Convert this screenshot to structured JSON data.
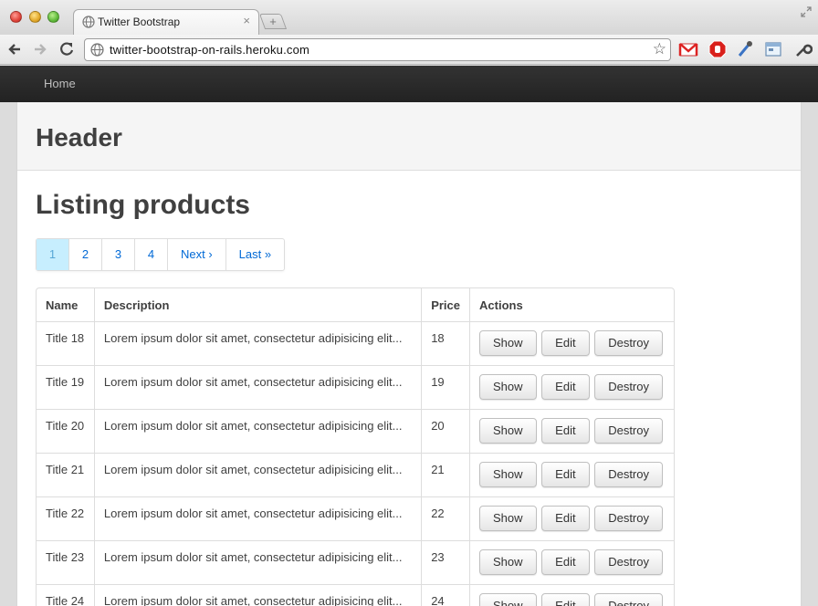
{
  "browser": {
    "tab_title": "Twitter Bootstrap",
    "tab_close": "×",
    "new_tab": "+",
    "url": "twitter-bootstrap-on-rails.heroku.com",
    "star": "☆"
  },
  "navbar": {
    "home": "Home"
  },
  "hero": {
    "title": "Header"
  },
  "main": {
    "title": "Listing products",
    "pagination": [
      "1",
      "2",
      "3",
      "4",
      "Next ›",
      "Last »"
    ],
    "table": {
      "headers": [
        "Name",
        "Description",
        "Price",
        "Actions"
      ],
      "rows": [
        {
          "name": "Title 18",
          "description": "Lorem ipsum dolor sit amet, consectetur adipisicing elit...",
          "price": "18"
        },
        {
          "name": "Title 19",
          "description": "Lorem ipsum dolor sit amet, consectetur adipisicing elit...",
          "price": "19"
        },
        {
          "name": "Title 20",
          "description": "Lorem ipsum dolor sit amet, consectetur adipisicing elit...",
          "price": "20"
        },
        {
          "name": "Title 21",
          "description": "Lorem ipsum dolor sit amet, consectetur adipisicing elit...",
          "price": "21"
        },
        {
          "name": "Title 22",
          "description": "Lorem ipsum dolor sit amet, consectetur adipisicing elit...",
          "price": "22"
        },
        {
          "name": "Title 23",
          "description": "Lorem ipsum dolor sit amet, consectetur adipisicing elit...",
          "price": "23"
        },
        {
          "name": "Title 24",
          "description": "Lorem ipsum dolor sit amet, consectetur adipisicing elit...",
          "price": "24"
        }
      ],
      "actions": {
        "show": "Show",
        "edit": "Edit",
        "destroy": "Destroy"
      }
    }
  },
  "colors": {
    "navbar": "#222222",
    "link": "#0069d6",
    "active_page": "#c7eefe"
  }
}
